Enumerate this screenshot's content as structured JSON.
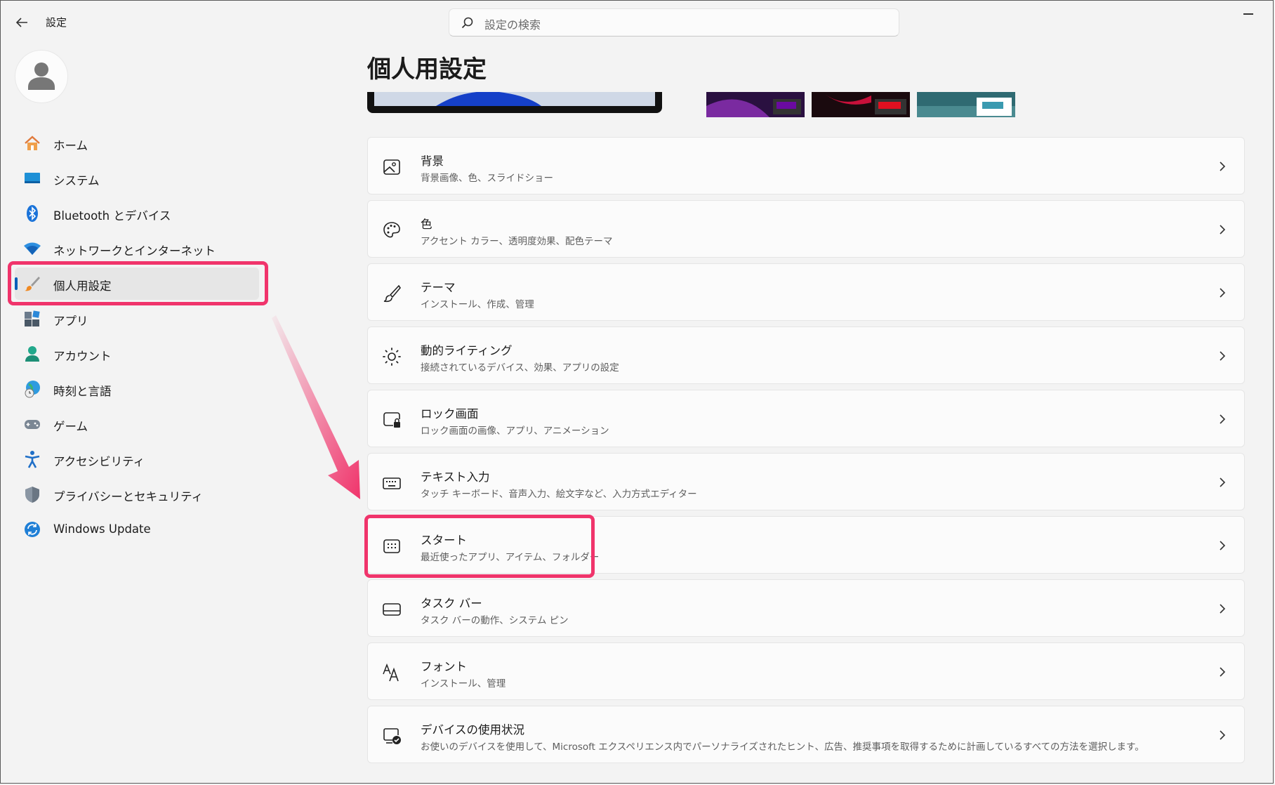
{
  "window": {
    "title": "設定"
  },
  "search": {
    "placeholder": "設定の検索"
  },
  "sidebar": {
    "items": [
      {
        "label": "ホーム",
        "icon": "home-icon"
      },
      {
        "label": "システム",
        "icon": "system-icon"
      },
      {
        "label": "Bluetooth とデバイス",
        "icon": "bluetooth-icon"
      },
      {
        "label": "ネットワークとインターネット",
        "icon": "wifi-icon"
      },
      {
        "label": "個人用設定",
        "icon": "paintbrush-icon",
        "selected": true
      },
      {
        "label": "アプリ",
        "icon": "apps-icon"
      },
      {
        "label": "アカウント",
        "icon": "account-icon"
      },
      {
        "label": "時刻と言語",
        "icon": "globe-clock-icon"
      },
      {
        "label": "ゲーム",
        "icon": "gamepad-icon"
      },
      {
        "label": "アクセシビリティ",
        "icon": "accessibility-icon"
      },
      {
        "label": "プライバシーとセキュリティ",
        "icon": "shield-icon"
      },
      {
        "label": "Windows Update",
        "icon": "update-icon"
      }
    ]
  },
  "main": {
    "title": "個人用設定",
    "rows": [
      {
        "title": "背景",
        "desc": "背景画像、色、スライドショー",
        "icon": "image-icon"
      },
      {
        "title": "色",
        "desc": "アクセント カラー、透明度効果、配色テーマ",
        "icon": "palette-icon"
      },
      {
        "title": "テーマ",
        "desc": "インストール、作成、管理",
        "icon": "brush-icon"
      },
      {
        "title": "動的ライティング",
        "desc": "接続されているデバイス、効果、アプリの設定",
        "icon": "lighting-icon"
      },
      {
        "title": "ロック画面",
        "desc": "ロック画面の画像、アプリ、アニメーション",
        "icon": "lock-screen-icon"
      },
      {
        "title": "テキスト入力",
        "desc": "タッチ キーボード、音声入力、絵文字など、入力方式エディター",
        "icon": "keyboard-icon"
      },
      {
        "title": "スタート",
        "desc": "最近使ったアプリ、アイテム、フォルダー",
        "icon": "start-icon"
      },
      {
        "title": "タスク バー",
        "desc": "タスク バーの動作、システム ピン",
        "icon": "taskbar-icon"
      },
      {
        "title": "フォント",
        "desc": "インストール、管理",
        "icon": "font-icon"
      },
      {
        "title": "デバイスの使用状況",
        "desc": "お使いのデバイスを使用して、Microsoft エクスペリエンス内でパーソナライズされたヒント、広告、推奨事項を取得するために計画しているすべての方法を選択します。",
        "icon": "device-usage-icon"
      }
    ]
  },
  "colors": {
    "accent": "#005fb8",
    "highlight": "#f0346b"
  }
}
